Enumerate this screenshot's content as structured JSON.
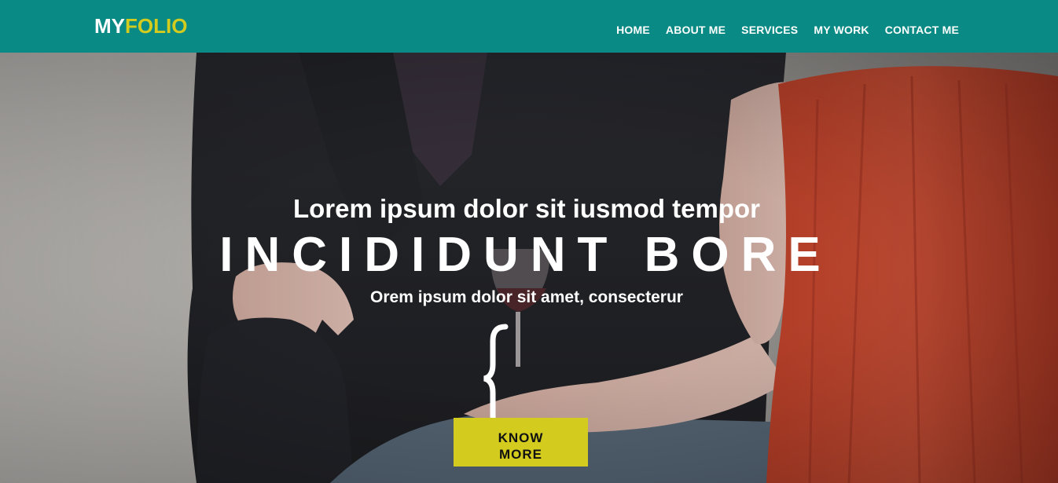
{
  "brand": {
    "part1": "MY",
    "part2": "FOLIO",
    "color_primary": "#ffffff",
    "color_accent": "#d3cc1f"
  },
  "navbar": {
    "background": "#0a8a85",
    "items": [
      {
        "label": "HOME"
      },
      {
        "label": "ABOUT ME"
      },
      {
        "label": "SERVICES"
      },
      {
        "label": "MY WORK"
      },
      {
        "label": "CONTACT ME"
      }
    ]
  },
  "hero": {
    "heading_small": "Lorem ipsum dolor sit iusmod tempor",
    "heading_large": "INCIDIDUNT BORE",
    "subheading": "Orem ipsum dolor sit amet, consecterur",
    "brace_icon": "curly-brace-icon",
    "cta_label": "KNOW MORE",
    "cta_color": "#d3cc1f",
    "background_image": "couple-with-wine-photo"
  }
}
